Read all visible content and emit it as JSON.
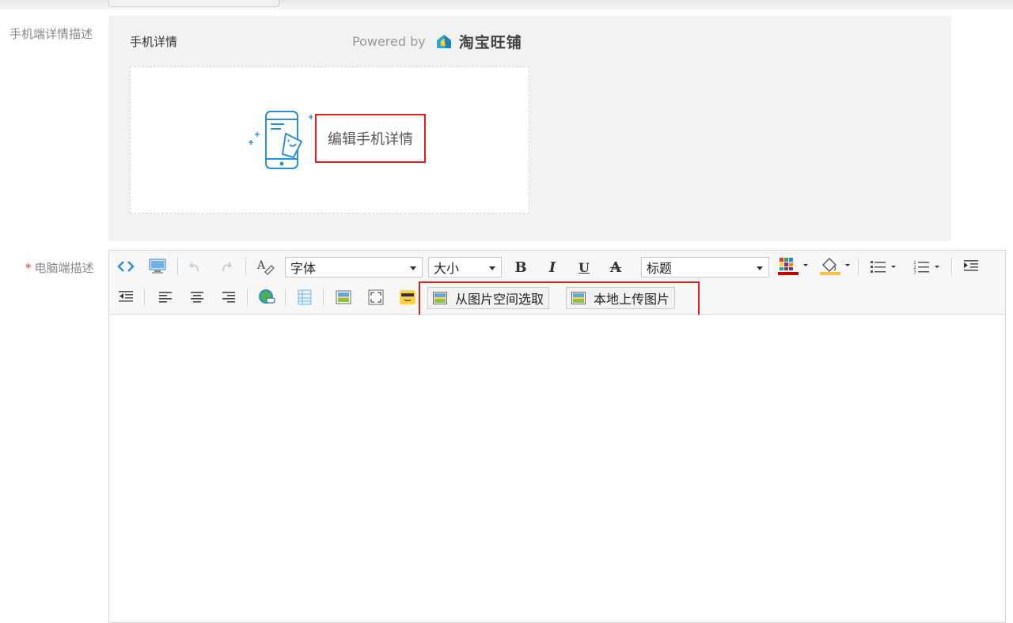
{
  "form": {
    "mobile_label": "手机端详情描述",
    "pc_required_mark": "*",
    "pc_label": "电脑端描述"
  },
  "mobile": {
    "title": "手机详情",
    "powered_by": "Powered by",
    "brand": "淘宝旺铺",
    "edit_button": "编辑手机详情"
  },
  "toolbar": {
    "font_select": "字体",
    "size_select": "大小",
    "heading_select": "标题",
    "bold": "B",
    "italic": "I",
    "underline": "U",
    "strike": "A",
    "pick_from_space": "从图片空间选取",
    "upload_local": "本地上传图片"
  },
  "colors": {
    "highlight": "#e02020",
    "icon_blue": "#2d8fd8",
    "font_color_bar": "#cc0000",
    "bg_color_bar": "#f5c542"
  }
}
